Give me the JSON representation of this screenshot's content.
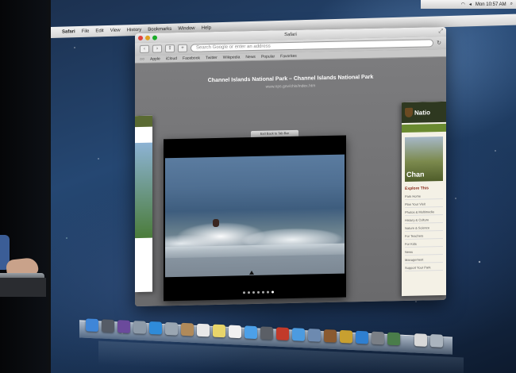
{
  "menubar": {
    "app_name": "Safari",
    "items": [
      "File",
      "Edit",
      "View",
      "History",
      "Bookmarks",
      "Window",
      "Help"
    ],
    "clock": "Mon 10:57 AM"
  },
  "window": {
    "title": "Safari",
    "address_placeholder": "Search Google or enter an address",
    "bookmarks": [
      "Apple",
      "iCloud",
      "Facebook",
      "Twitter",
      "Wikipedia",
      "News",
      "Popular",
      "Favorites"
    ],
    "tab_title": "Channel Islands National Park – Channel Islands National Park",
    "tab_url": "www.nps.gov/chis/index.htm",
    "exit_fullscreen_label": "Exit Back to Tab Bar",
    "right_page": {
      "header_word": "Natio",
      "photo_title": "Chan",
      "section_heading": "Explore This",
      "links": [
        "Park Home",
        "Plan Your Visit",
        "Photos & Multimedia",
        "History & Culture",
        "Nature & Science",
        "For Teachers",
        "For Kids",
        "News",
        "Management",
        "Support Your Park"
      ]
    },
    "page_dots": 7,
    "active_dot": 6
  },
  "dock": {
    "icons": [
      {
        "name": "finder-icon",
        "color": "#3f86d8"
      },
      {
        "name": "dashboard-icon",
        "color": "#555b66"
      },
      {
        "name": "mission-control-icon",
        "color": "#6b4a9c"
      },
      {
        "name": "launchpad-icon",
        "color": "#8d9aa8"
      },
      {
        "name": "safari-icon",
        "color": "#2f8bd9"
      },
      {
        "name": "mail-icon",
        "color": "#9aa6b2"
      },
      {
        "name": "contacts-icon",
        "color": "#b08a5a"
      },
      {
        "name": "calendar-icon",
        "color": "#e8e8e8"
      },
      {
        "name": "notes-icon",
        "color": "#e8d56a"
      },
      {
        "name": "reminders-icon",
        "color": "#f0f0f0"
      },
      {
        "name": "messages-icon",
        "color": "#4ca0e8"
      },
      {
        "name": "facetime-icon",
        "color": "#5b5f66"
      },
      {
        "name": "photo-booth-icon",
        "color": "#c23a2a"
      },
      {
        "name": "itunes-icon",
        "color": "#4c9be0"
      },
      {
        "name": "iphoto-icon",
        "color": "#6d8ab0"
      },
      {
        "name": "imovie-icon",
        "color": "#8a5a30"
      },
      {
        "name": "garageband-icon",
        "color": "#c8a030"
      },
      {
        "name": "app-store-icon",
        "color": "#2f7fd0"
      },
      {
        "name": "system-preferences-icon",
        "color": "#7a7f86"
      },
      {
        "name": "time-machine-icon",
        "color": "#4a7d4a"
      },
      {
        "name": "preview-icon",
        "color": "#d8d8d8"
      },
      {
        "name": "trash-icon",
        "color": "#aab4be"
      }
    ]
  }
}
